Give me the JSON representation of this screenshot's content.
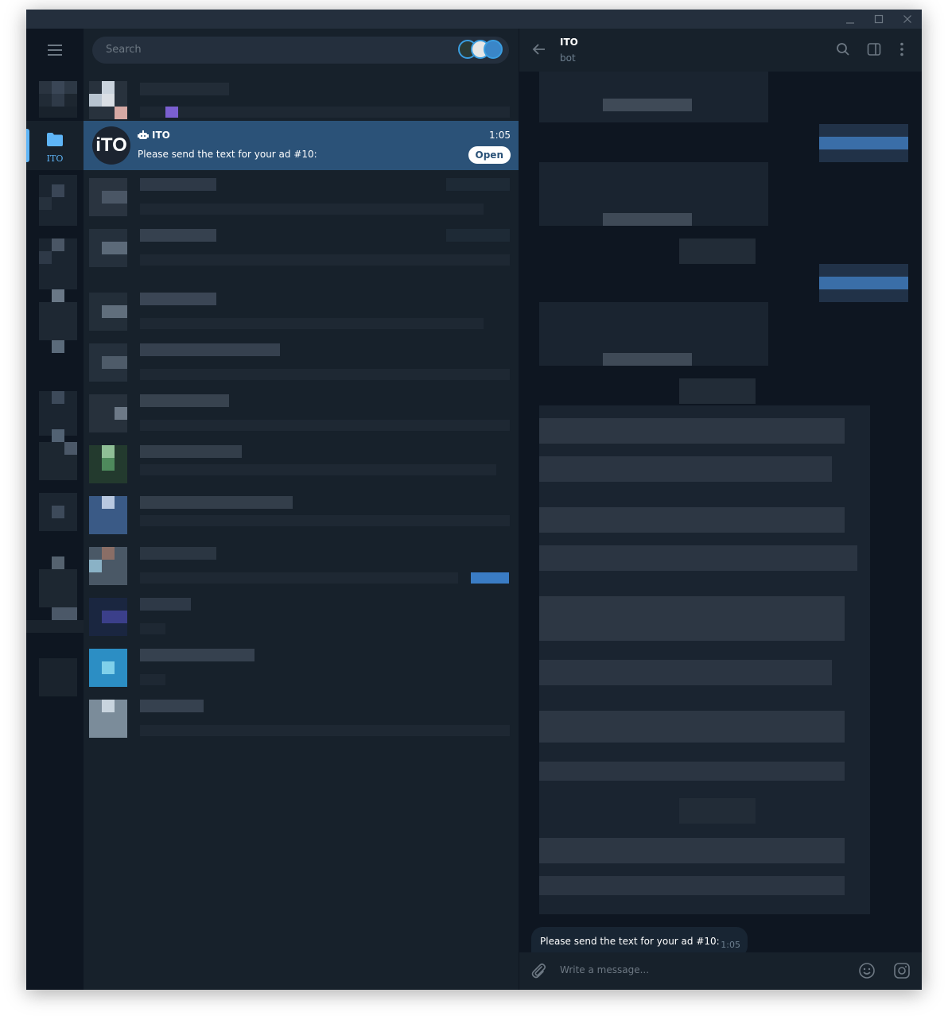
{
  "window": {
    "controls": [
      "minimize-icon",
      "maximize-icon",
      "close-icon"
    ]
  },
  "sidebar": {
    "menu_icon": "hamburger-icon",
    "folders": [
      {
        "label": "ITO",
        "icon": "folder-icon",
        "active": true
      }
    ]
  },
  "search": {
    "placeholder": "Search"
  },
  "chat_list": {
    "active_chat": {
      "name": "ITO",
      "is_bot": true,
      "time": "1:05",
      "preview": "Please send the text for your ad #10:",
      "action_label": "Open",
      "avatar_text": "iTO"
    }
  },
  "chat": {
    "title": "ITO",
    "subtitle": "bot",
    "last_message": {
      "text": "Please send the text for your ad #10:",
      "time": "1:05"
    },
    "composer_placeholder": "Write a message...",
    "header_icons": [
      "search-icon",
      "sidebar-toggle-icon",
      "more-vertical-icon"
    ]
  },
  "colors": {
    "accent": "#5eb5f7",
    "active_row": "#2b5278",
    "panel": "#17212b",
    "background": "#0e1621"
  }
}
